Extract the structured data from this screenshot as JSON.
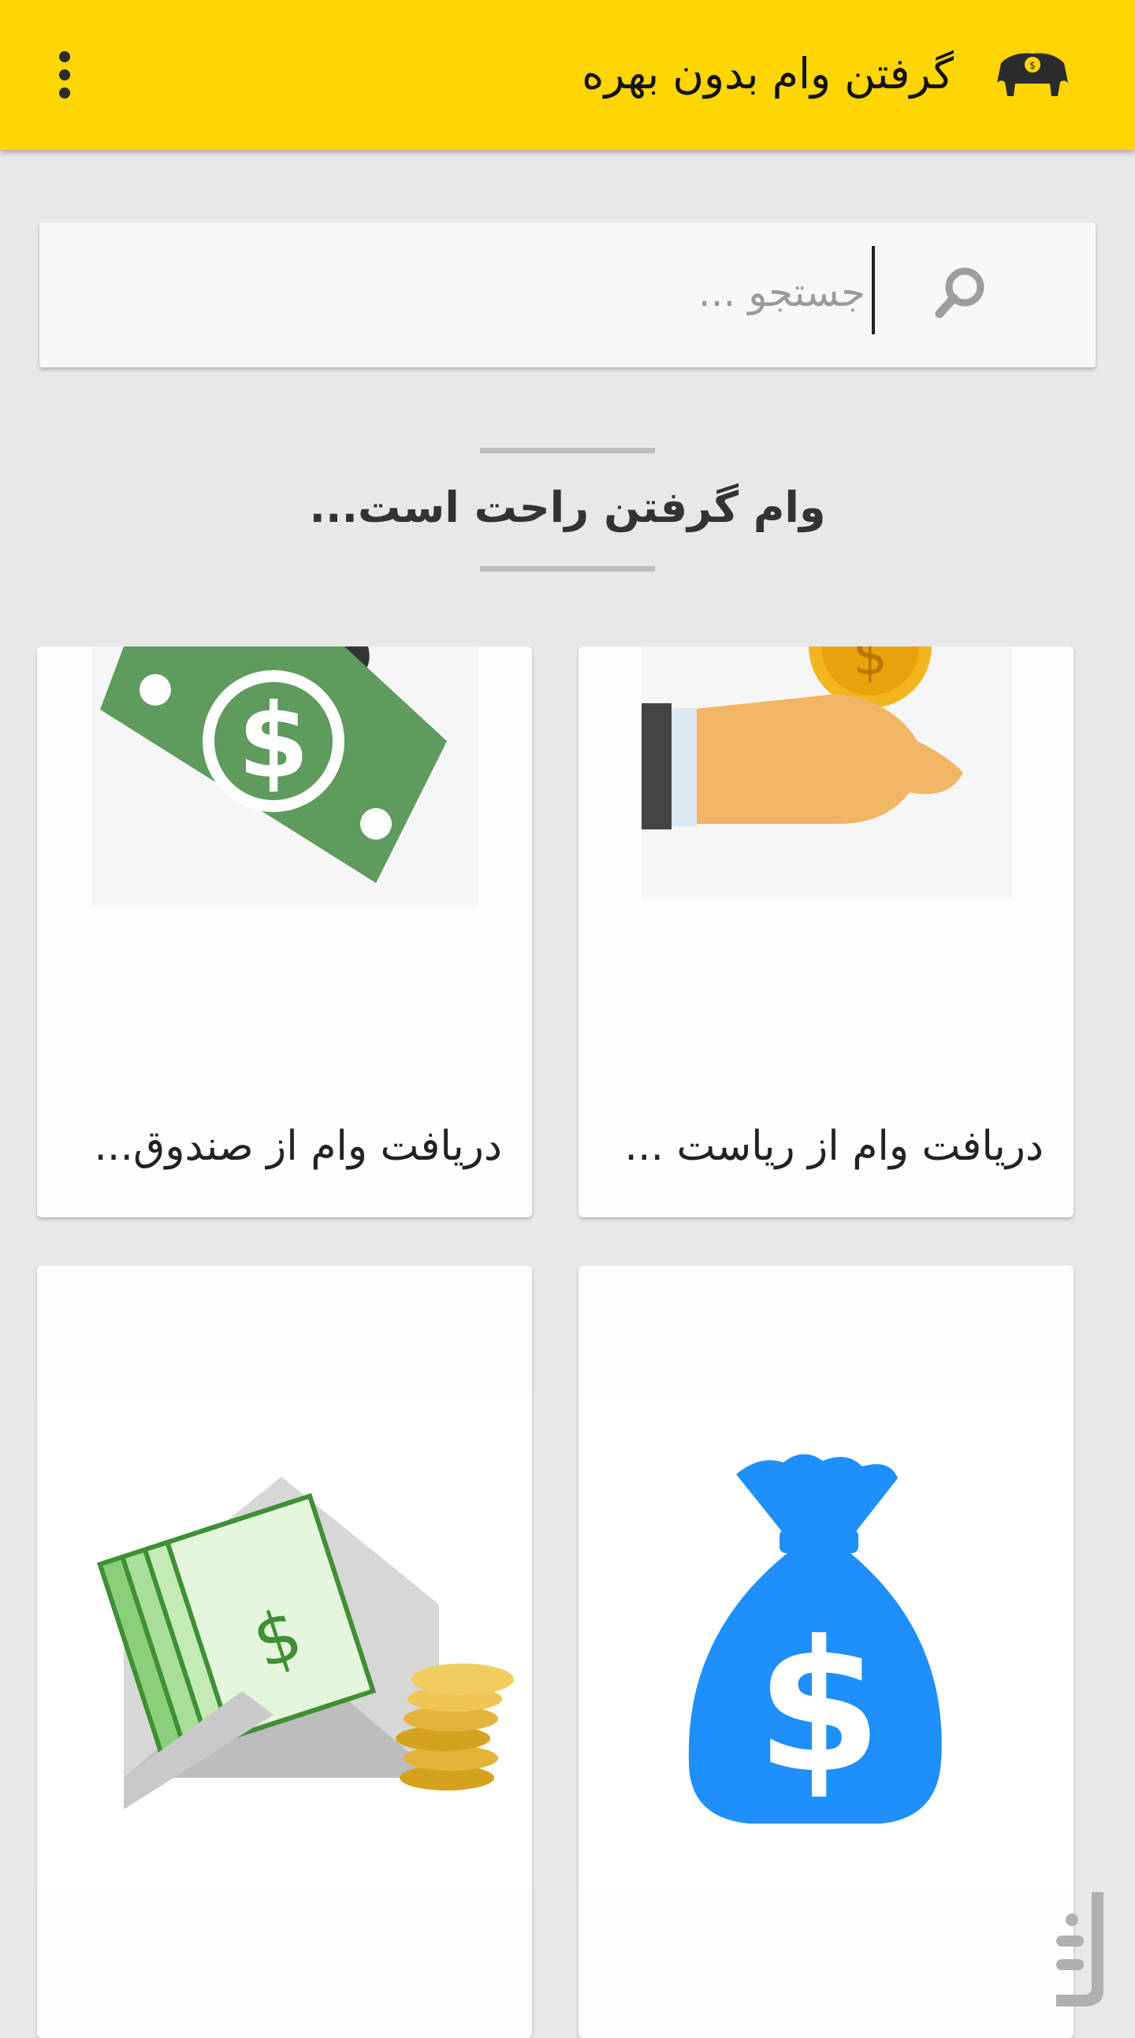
{
  "app": {
    "title": "گرفتن وام بدون بهره",
    "accent": "#fdd500"
  },
  "toolbar": {
    "logo_icon": "elephant-logo-icon",
    "menu_icon": "more-vertical-icon"
  },
  "search": {
    "placeholder": "جستجو ...",
    "icon": "search-icon"
  },
  "section": {
    "title": "وام گرفتن راحت است..."
  },
  "cards": [
    {
      "label": "دریافت وام از ریاست ...",
      "icon": "hand-coin-icon"
    },
    {
      "label": "دریافت وام از صندوق...",
      "icon": "dollar-bill-icon"
    },
    {
      "label": "",
      "icon": "money-bag-icon"
    },
    {
      "label": "",
      "icon": "envelope-money-icon"
    }
  ],
  "watermark": {
    "icon": "store-watermark-icon"
  }
}
